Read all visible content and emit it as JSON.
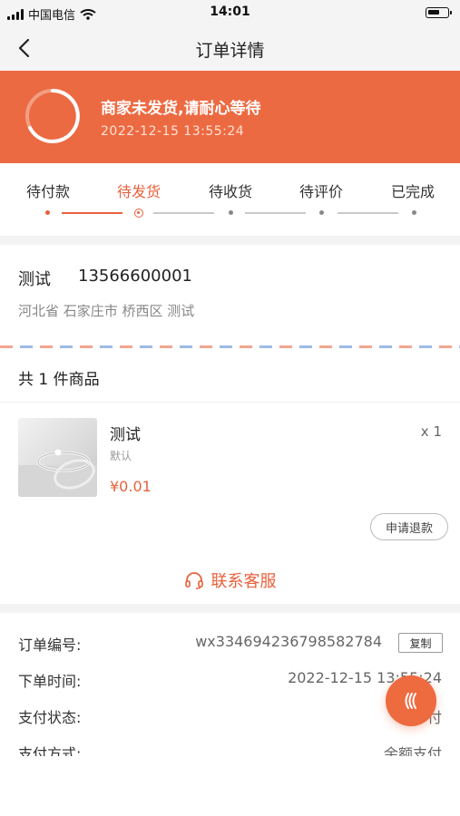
{
  "status_bar": {
    "carrier": "中国电信",
    "time": "14:01"
  },
  "nav": {
    "title": "订单详情",
    "back_icon": "chevron-left-icon"
  },
  "banner": {
    "title": "商家未发货,请耐心等待",
    "datetime": "2022-12-15   13:55:24",
    "background": "#ec6a42"
  },
  "steps": {
    "items": [
      "待付款",
      "待发货",
      "待收货",
      "待评价",
      "已完成"
    ],
    "active_index": 1,
    "accent": "#e8613b"
  },
  "address": {
    "name": "测试",
    "phone": "13566600001",
    "detail": "河北省 石家庄市 桥西区 测试"
  },
  "goods": {
    "header": "共 1 件商品",
    "name": "测试",
    "spec": "默认",
    "price": "¥0.01",
    "quantity": "x 1",
    "refund_label": "申请退款"
  },
  "service": {
    "label": "联系客服",
    "icon": "headset-icon"
  },
  "order_info": {
    "order_no_label": "订单编号:",
    "order_no_value": "wx334694236798582784",
    "copy_label": "复制",
    "order_time_label": "下单时间:",
    "order_time_value": "2022-12-15 13:55:24",
    "pay_status_label": "支付状态:",
    "pay_status_value": "付",
    "pay_method_label": "支付方式:",
    "pay_method_value": "余额支付"
  },
  "float_button": {
    "icon": "collapse-arrows-icon"
  }
}
